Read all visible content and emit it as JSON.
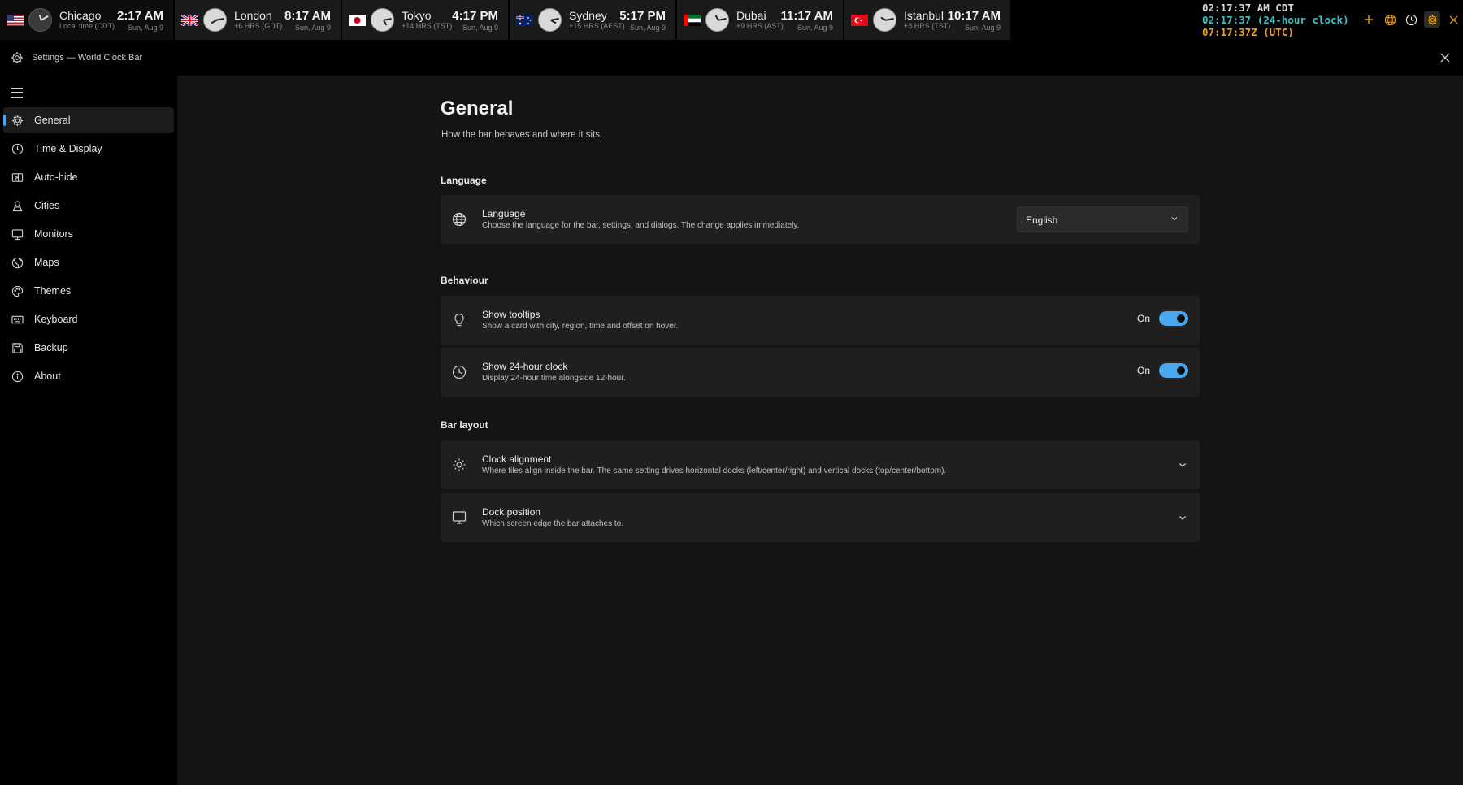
{
  "clockbar": {
    "tiles": [
      {
        "city": "Chicago",
        "sub": "Local time (CDT)",
        "time": "2:17 AM",
        "date": "Sun, Aug 9",
        "flag": "us-flag-icon"
      },
      {
        "city": "London",
        "sub": "+6 HRS (GDT)",
        "time": "8:17 AM",
        "date": "Sun, Aug 9",
        "flag": "uk-flag-icon"
      },
      {
        "city": "Tokyo",
        "sub": "+14 HRS (TST)",
        "time": "4:17 PM",
        "date": "Sun, Aug 9",
        "flag": "japan-flag-icon"
      },
      {
        "city": "Sydney",
        "sub": "+15 HRS (AEST)",
        "time": "5:17 PM",
        "date": "Sun, Aug 9",
        "flag": "australia-flag-icon"
      },
      {
        "city": "Dubai",
        "sub": "+9 HRS (AST)",
        "time": "11:17 AM",
        "date": "Sun, Aug 9",
        "flag": "uae-flag-icon"
      },
      {
        "city": "Istanbul",
        "sub": "+8 HRS (TST)",
        "time": "10:17 AM",
        "date": "Sun, Aug 9",
        "flag": "turkey-flag-icon"
      }
    ],
    "digital": {
      "line1": "02:17:37 AM CDT",
      "line2": "02:17:37 (24-hour clock)",
      "line3": "07:17:37Z (UTC)"
    },
    "icons": [
      "add-icon",
      "globe-icon",
      "clock-icon",
      "gear-icon",
      "close-icon"
    ],
    "colors": {
      "line2": "#3fc2c6",
      "line3": "#f0a020",
      "icon": "#e0a020"
    }
  },
  "window": {
    "title": "Settings — World Clock Bar",
    "close_icon": "close-icon"
  },
  "sidebar": {
    "items": [
      {
        "label": "General",
        "icon": "gear-icon",
        "active": true
      },
      {
        "label": "Time & Display",
        "icon": "clock-icon"
      },
      {
        "label": "Auto-hide",
        "icon": "auto-hide-icon"
      },
      {
        "label": "Cities",
        "icon": "person-icon"
      },
      {
        "label": "Monitors",
        "icon": "monitor-icon"
      },
      {
        "label": "Maps",
        "icon": "globe-icon"
      },
      {
        "label": "Themes",
        "icon": "palette-icon"
      },
      {
        "label": "Keyboard",
        "icon": "keyboard-icon"
      },
      {
        "label": "Backup",
        "icon": "save-icon"
      },
      {
        "label": "About",
        "icon": "info-icon"
      }
    ],
    "accent": "#4aa3e8"
  },
  "main": {
    "title": "General",
    "subtitle": "How the bar behaves and where it sits.",
    "sections": {
      "language": {
        "heading": "Language",
        "card": {
          "title": "Language",
          "desc": "Choose the language for the bar, settings, and dialogs. The change applies immediately.",
          "selected": "English"
        }
      },
      "behaviour": {
        "heading": "Behaviour",
        "tooltips": {
          "title": "Show tooltips",
          "desc": "Show a card with city, region, time and offset on hover.",
          "state": "On"
        },
        "clock24": {
          "title": "Show 24-hour clock",
          "desc": "Display 24-hour time alongside 12-hour.",
          "state": "On"
        }
      },
      "layout": {
        "heading": "Bar layout",
        "alignment": {
          "title": "Clock alignment",
          "desc": "Where tiles align inside the bar. The same setting drives horizontal docks (left/center/right) and vertical docks (top/center/bottom)."
        },
        "dock": {
          "title": "Dock position",
          "desc": "Which screen edge the bar attaches to."
        }
      }
    },
    "toggle_color": "#4aa8ee"
  }
}
